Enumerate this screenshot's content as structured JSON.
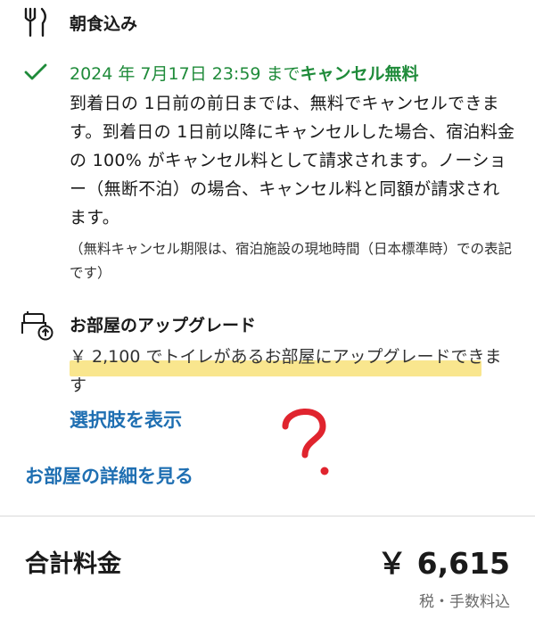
{
  "breakfast": {
    "icon": "utensils-icon",
    "label": "朝食込み"
  },
  "cancellation": {
    "icon": "checkmark-icon",
    "deadline_text": "2024 年 7月17日 23:59 まで",
    "free_label": "キャンセル無料",
    "policy_text": "到着日の 1日前の前日までは、無料でキャンセルできます。到着日の 1日前以降にキャンセルした場合、宿泊料金の 100% がキャンセル料として請求されます。ノーショー（無断不泊）の場合、キャンセル料と同額が請求されます。",
    "note_text": "（無料キャンセル期限は、宿泊施設の現地時間（日本標準時）での表記です）",
    "accent_color": "#1f8b3a"
  },
  "room_upgrade": {
    "icon": "room-upgrade-icon",
    "title": "お部屋のアップグレード",
    "description": "￥ 2,100 でトイレがあるお部屋にアップグレードできます",
    "show_options_link": "選択肢を表示",
    "annotation": "?",
    "annotation_color": "#e0242e",
    "highlight_color": "#f8e27a"
  },
  "room_details_link": "お部屋の詳細を見る",
  "total": {
    "label": "合計料金",
    "price": "￥ 6,615",
    "note": "税・手数料込"
  },
  "link_color": "#1f6fb2"
}
